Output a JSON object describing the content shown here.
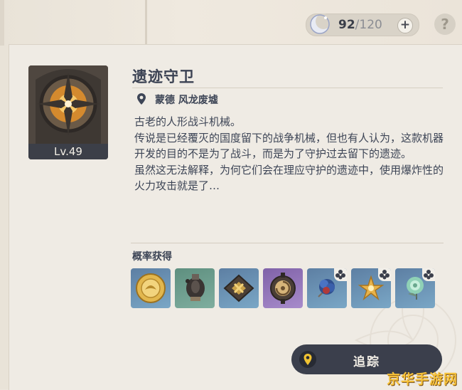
{
  "resin": {
    "current": "92",
    "max": "/120",
    "icon": "moon-resin-icon"
  },
  "help": {
    "label": "?"
  },
  "enemy": {
    "level_label": "Lv.49",
    "name": "遗迹守卫",
    "location": "蒙德 风龙废墟",
    "description": [
      "古老的人形战斗机械。",
      "传说是已经覆灭的国度留下的战争机械，但也有人认为，这款机器开发的目的不是为了战斗，而是为了守护过去留下的遗迹。",
      "虽然这无法解释，为何它们会在理应守护的遗迹中，使用爆炸性的火力攻击就是了…"
    ]
  },
  "drops": {
    "label": "概率获得",
    "items": [
      {
        "icon": "gold-coin-icon",
        "rarity": "blue",
        "has_badge": false
      },
      {
        "icon": "chaos-gear-icon",
        "rarity": "green",
        "has_badge": false
      },
      {
        "icon": "chaos-device-icon",
        "rarity": "blue",
        "has_badge": false
      },
      {
        "icon": "chaos-circuit-icon",
        "rarity": "purple",
        "has_badge": false
      },
      {
        "icon": "artifact-flower-blue-icon",
        "rarity": "blue",
        "has_badge": true
      },
      {
        "icon": "artifact-flower-gold-icon",
        "rarity": "blue",
        "has_badge": true
      },
      {
        "icon": "artifact-flower-green-icon",
        "rarity": "blue",
        "has_badge": true
      }
    ]
  },
  "track": {
    "label": "追踪"
  },
  "watermark": "京华手游网"
}
